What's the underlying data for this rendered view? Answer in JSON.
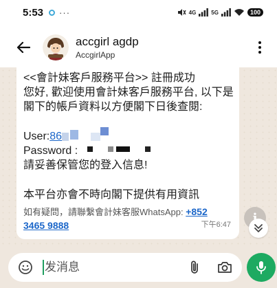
{
  "status_bar": {
    "time": "5:53",
    "more": "···",
    "signal_1": "4G",
    "signal_2": "5G",
    "battery": "100"
  },
  "header": {
    "contact_name": "accgirl agdp",
    "contact_subtitle": "AccgirlApp"
  },
  "message": {
    "line_1": "<<會計妹客戶服務平台>> 註冊成功",
    "line_2": "您好, 歡迎使用會計妹客戶服務平台, 以下是",
    "line_3": "閣下的帳戶資料以方便閣下日後查閱:",
    "user_label": "User: ",
    "user_visible": "86",
    "password_label": "Password :",
    "line_keep": "請妥善保管您的登入信息!",
    "line_info": "本平台亦會不時向閣下提供有用資訊",
    "contact_text": "如有疑問，請聯繫會計妹客服WhatsApp: ",
    "phone_part1": "+852",
    "phone_part2": "3465 9888",
    "time": "下午6:47"
  },
  "input": {
    "placeholder": "发消息"
  },
  "colors": {
    "chat_background": "#efe7de",
    "accent_green": "#1daa61",
    "link_blue": "#1b66c9"
  },
  "icons": {
    "back": "arrow-left-icon",
    "menu": "more-vert-icon",
    "info": "info-icon",
    "scroll": "double-chevron-down-icon",
    "emoji": "sticker-icon",
    "attach": "paperclip-icon",
    "camera": "camera-icon",
    "mic": "microphone-icon"
  }
}
